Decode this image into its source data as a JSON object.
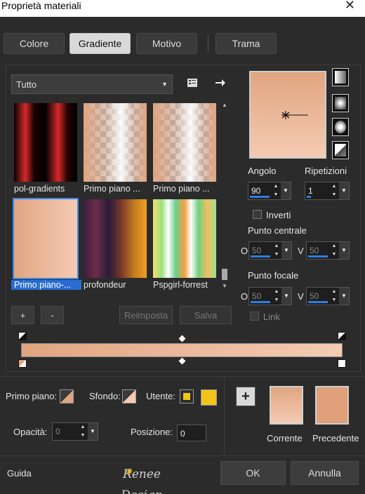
{
  "window": {
    "title": "Proprietà materiali",
    "close_glyph": "✕"
  },
  "tabs": [
    {
      "label": "Colore"
    },
    {
      "label": "Gradiente"
    },
    {
      "label": "Motivo"
    },
    {
      "label": "Trama"
    }
  ],
  "active_tab": "Gradiente",
  "category": {
    "value": "Tutto"
  },
  "gradients": [
    {
      "label": "pol-gradients"
    },
    {
      "label": "Primo piano ..."
    },
    {
      "label": "Primo piano ..."
    },
    {
      "label": "Primo piano-..."
    },
    {
      "label": "profondeur"
    },
    {
      "label": "Pspgirl-forrest"
    }
  ],
  "selected_gradient": "Primo piano-...",
  "buttons": {
    "add": "+",
    "remove": "-",
    "reset": "Reimposta",
    "save": "Salva"
  },
  "angle": {
    "label": "Angolo",
    "value": "90"
  },
  "repeats": {
    "label": "Ripetizioni",
    "value": "1"
  },
  "invert": {
    "label": "Inverti",
    "checked": false
  },
  "center_point": {
    "label": "Punto centrale",
    "o_label": "O",
    "o_value": "50",
    "v_label": "V",
    "v_value": "50"
  },
  "focal_point": {
    "label": "Punto focale",
    "o_label": "O",
    "o_value": "50",
    "v_label": "V",
    "v_value": "50"
  },
  "link": {
    "label": "Link",
    "checked": false
  },
  "bottom": {
    "foreground_label": "Primo piano:",
    "background_label": "Sfondo:",
    "user_label": "Utente:",
    "opacity_label": "Opacità:",
    "opacity_value": "0",
    "position_label": "Posizione:",
    "position_value": "0",
    "add_glyph": "+",
    "current_label": "Corrente",
    "previous_label": "Precedente"
  },
  "footer": {
    "help": "Guida",
    "logo": "Renee Design",
    "ok": "OK",
    "cancel": "Annulla"
  },
  "colors": {
    "foreground": "#e0a581",
    "background": "#f5cbb3",
    "user": "#f2c419",
    "accent": "#2f7de1"
  }
}
